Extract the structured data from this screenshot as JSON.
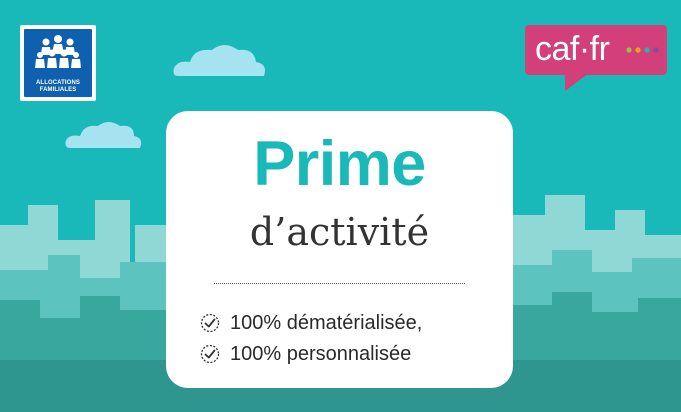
{
  "header": {
    "logo_left": {
      "icon": "allocations-familiales-logo-icon",
      "label_line1": "ALLOCATIONS",
      "label_line2": "FAMILIALES"
    },
    "logo_right": {
      "text": "caf·fr"
    }
  },
  "card": {
    "title": "Prime",
    "subtitle": "d’activité",
    "features": [
      {
        "icon": "check-circle-icon",
        "text": "100% dématérialisée,"
      },
      {
        "icon": "check-circle-icon",
        "text": "100% personnalisée"
      }
    ]
  },
  "colors": {
    "background": "#19b9b9",
    "title": "#19b9b9",
    "caf_badge": "#d23f79",
    "allocations_blue": "#0f61b0",
    "dot_colors": [
      "#8cc63f",
      "#f7a21b",
      "#19b9b9",
      "#7b4fa0"
    ]
  }
}
